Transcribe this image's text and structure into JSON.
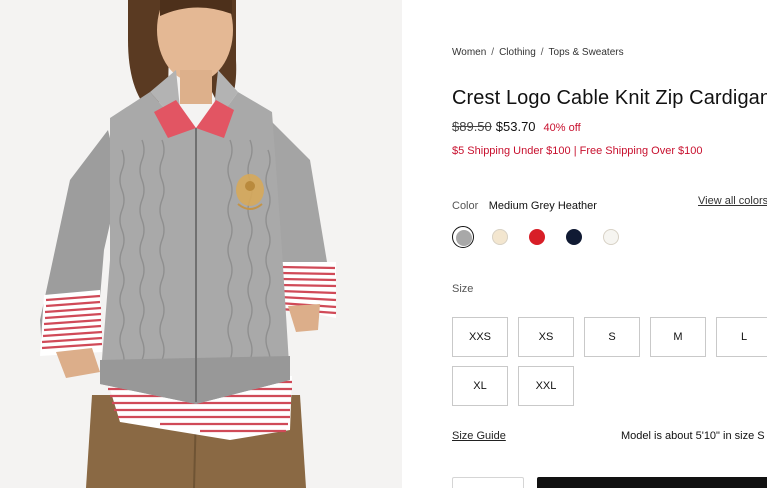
{
  "product_image": {
    "alt": "Model wearing a grey cable knit zip cardigan over a red striped shirt"
  },
  "breadcrumb": [
    {
      "label": "Women"
    },
    {
      "label": "Clothing"
    },
    {
      "label": "Tops & Sweaters"
    }
  ],
  "breadcrumb_separator": "/",
  "product": {
    "title": "Crest Logo Cable Knit Zip Cardigan",
    "price_original": "$89.50",
    "price_sale": "$53.70",
    "discount": "40% off",
    "shipping_note": "$5 Shipping Under $100 | Free Shipping Over $100"
  },
  "color": {
    "label": "Color",
    "selected_name": "Medium Grey Heather",
    "view_all_label": "View all colors",
    "swatches": [
      {
        "name": "Medium Grey Heather",
        "hex": "#a8a8a8",
        "selected": true
      },
      {
        "name": "Cream",
        "hex": "#f3e6cf",
        "selected": false
      },
      {
        "name": "Red",
        "hex": "#d81e27",
        "selected": false
      },
      {
        "name": "Navy",
        "hex": "#101a33",
        "selected": false
      },
      {
        "name": "White",
        "hex": "#f6f5f1",
        "selected": false
      }
    ]
  },
  "size": {
    "label": "Size",
    "options": [
      "XXS",
      "XS",
      "S",
      "M",
      "L",
      "XL",
      "XXL"
    ]
  },
  "size_guide_label": "Size Guide",
  "model_info": "Model is about 5'10\" in size S",
  "colors": {
    "sale_red": "#c8102e",
    "primary_black": "#111111"
  }
}
